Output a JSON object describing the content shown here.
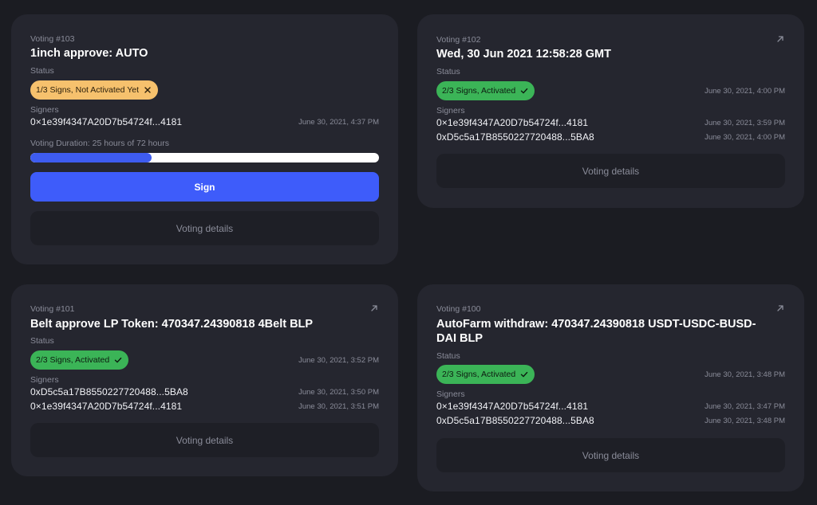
{
  "cards": [
    {
      "voting": "Voting #103",
      "title": "1inch approve: AUTO",
      "status_label": "Status",
      "status": "1/3 Signs, Not Activated Yet",
      "status_type": "pending",
      "status_color": "#f6c16d",
      "signers_label": "Signers",
      "signers": [
        {
          "address": "0×1e39f4347A20D7b54724f...4181",
          "date": "June 30, 2021, 4:37 PM"
        }
      ],
      "duration": "Voting Duration: 25 hours of 72 hours",
      "progress": 0.347,
      "sign_label": "Sign",
      "details_label": "Voting details"
    },
    {
      "voting": "Voting #102",
      "title": "Wed, 30 Jun 2021 12:58:28 GMT",
      "status_label": "Status",
      "status": "2/3 Signs, Activated",
      "status_type": "activated",
      "status_color": "#3bb457",
      "status_date": "June 30, 2021, 4:00 PM",
      "signers_label": "Signers",
      "signers": [
        {
          "address": "0×1e39f4347A20D7b54724f...4181",
          "date": "June 30, 2021, 3:59 PM"
        },
        {
          "address": "0xD5c5a17B8550227720488...5BA8",
          "date": "June 30, 2021, 4:00 PM"
        }
      ],
      "details_label": "Voting details"
    },
    {
      "voting": "Voting #101",
      "title": "Belt approve LP Token: 470347.24390818 4Belt BLP",
      "status_label": "Status",
      "status": "2/3 Signs, Activated",
      "status_type": "activated",
      "status_color": "#3bb457",
      "status_date": "June 30, 2021, 3:52 PM",
      "signers_label": "Signers",
      "signers": [
        {
          "address": "0xD5c5a17B8550227720488...5BA8",
          "date": "June 30, 2021, 3:50 PM"
        },
        {
          "address": "0×1e39f4347A20D7b54724f...4181",
          "date": "June 30, 2021, 3:51 PM"
        }
      ],
      "details_label": "Voting details"
    },
    {
      "voting": "Voting #100",
      "title": "AutoFarm withdraw: 470347.24390818 USDT-USDC-BUSD-DAI BLP",
      "status_label": "Status",
      "status": "2/3 Signs, Activated",
      "status_type": "activated",
      "status_color": "#3bb457",
      "status_date": "June 30, 2021, 3:48 PM",
      "signers_label": "Signers",
      "signers": [
        {
          "address": "0×1e39f4347A20D7b54724f...4181",
          "date": "June 30, 2021, 3:47 PM"
        },
        {
          "address": "0xD5c5a17B8550227720488...5BA8",
          "date": "June 30, 2021, 3:48 PM"
        }
      ],
      "details_label": "Voting details"
    }
  ],
  "icons": {
    "external": "external-link-icon",
    "check": "check-icon",
    "close": "close-icon"
  },
  "colors": {
    "background": "#1b1c22",
    "card": "#25262f",
    "accent": "#3e5cfa",
    "muted": "#8a8c99"
  }
}
